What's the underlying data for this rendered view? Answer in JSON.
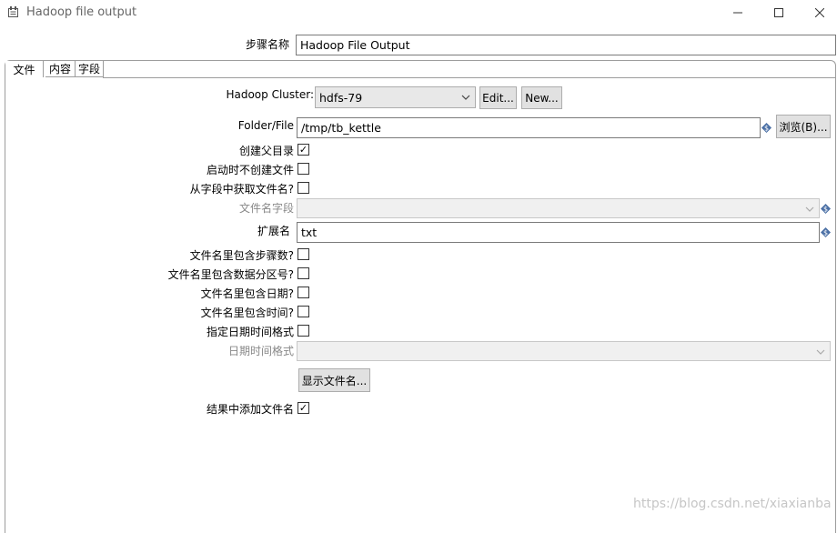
{
  "window": {
    "title": "Hadoop file output",
    "minimize": "—",
    "maximize": "☐",
    "close": "✕"
  },
  "step_name": {
    "label": "步骤名称",
    "value": "Hadoop File Output"
  },
  "tabs": [
    {
      "label": "文件",
      "active": true
    },
    {
      "label": "内容",
      "active": false
    },
    {
      "label": "字段",
      "active": false
    }
  ],
  "form": {
    "cluster": {
      "label": "Hadoop Cluster:",
      "value": "hdfs-79",
      "edit_button": "Edit...",
      "new_button": "New..."
    },
    "folder": {
      "label": "Folder/File",
      "value": "/tmp/tb_kettle",
      "browse_button": "浏览(B)..."
    },
    "create_parent": {
      "label": "创建父目录",
      "checked": true
    },
    "no_create_on_start": {
      "label": "启动时不创建文件",
      "checked": false
    },
    "filename_from_field": {
      "label": "从字段中获取文件名?",
      "checked": false
    },
    "filename_field": {
      "label": "文件名字段",
      "value": ""
    },
    "extension": {
      "label": "扩展名",
      "value": "txt"
    },
    "include_stepnr": {
      "label": "文件名里包含步骤数?",
      "checked": false
    },
    "include_partition": {
      "label": "文件名里包含数据分区号?",
      "checked": false
    },
    "include_date": {
      "label": "文件名里包含日期?",
      "checked": false
    },
    "include_time": {
      "label": "文件名里包含时间?",
      "checked": false
    },
    "specify_format": {
      "label": "指定日期时间格式",
      "checked": false
    },
    "datetime_format": {
      "label": "日期时间格式",
      "value": ""
    },
    "show_filenames_button": "显示文件名...",
    "add_to_result": {
      "label": "结果中添加文件名",
      "checked": true
    }
  },
  "check_mark": "✓",
  "watermark": "https://blog.csdn.net/xiaxianba",
  "colors": {
    "variable_icon": "#4a6fa5",
    "window_bg": "#ffffff",
    "button_bg": "#e1e1e1"
  }
}
